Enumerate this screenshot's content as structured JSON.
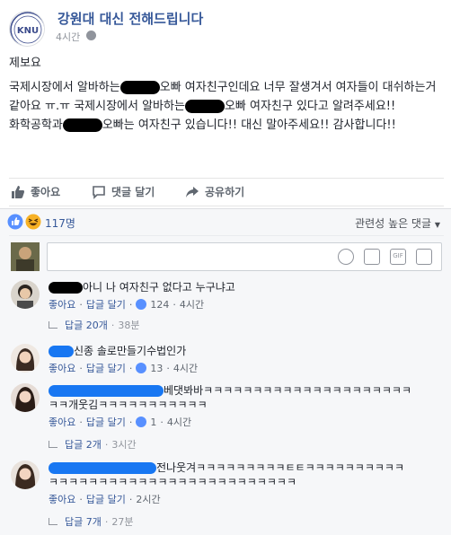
{
  "post": {
    "page_name": "강원대 대신 전해드립니다",
    "time": "4시간",
    "logo_text": "KNU",
    "paragraphs": [
      "제보요",
      "국제시장에서 알바하는",
      "오빠 여자친구인데요 너무 잘생겨서 여자들이 대쉬하는거 같아요 ㅠ.ㅠ 국제시장에서 알바하는",
      "오빠 여자친구 있다고 알려주세요!!",
      "화학공학과",
      "오빠는 여자친구 있습니다!! 대신 말아주세요!! 감사합니다!!"
    ]
  },
  "actions": {
    "like": "좋아요",
    "comment": "댓글 달기",
    "share": "공유하기"
  },
  "reactions": {
    "count": "117명",
    "sort": "관련성 높은 댓글"
  },
  "comments": [
    {
      "text": "아니 나 여자친구 없다고 누구냐고",
      "like": "좋아요",
      "reply": "답글 달기",
      "likes": "124",
      "time": "4시간",
      "replies_label": "답글 20개",
      "replies_time": "38분"
    },
    {
      "text": "신종 솔로만들기수법인가",
      "like": "좋아요",
      "reply": "답글 달기",
      "likes": "13",
      "time": "4시간"
    },
    {
      "text_line1": "베댓봐바ㅋㅋㅋㅋㅋㅋㅋㅋㅋㅋㅋㅋㅋㅋㅋㅋㅋㅋㅋㅋㅋ",
      "text_line2": "ㅋㅋ개웃김ㅋㅋㅋㅋㅋㅋㅋㅋㅋㅋㅋ",
      "like": "좋아요",
      "reply": "답글 달기",
      "likes": "1",
      "time": "4시간",
      "replies_label": "답글 2개",
      "replies_time": "3시간"
    },
    {
      "text_line1": "전나웃겨ㅋㅋㅋㅋㅋㅋㅋㅋㅋㅌㅌㅋㅋㅋㅋㅋㅋㅋㅋㅋㅋ",
      "text_line2": "ㅋㅋㅋㅋㅋㅋㅋㅋㅋㅋㅋㅋㅋㅋㅋㅋㅋㅋㅋㅋㅋㅋㅋㅋㅋ",
      "like": "좋아요",
      "reply": "답글 달기",
      "time": "2시간",
      "replies_label": "답글 7개",
      "replies_time": "27분"
    }
  ],
  "colors": {
    "link": "#365899",
    "like_blue": "#5890ff",
    "name_redact": "#1877f2",
    "meta_gray": "#90949c"
  }
}
